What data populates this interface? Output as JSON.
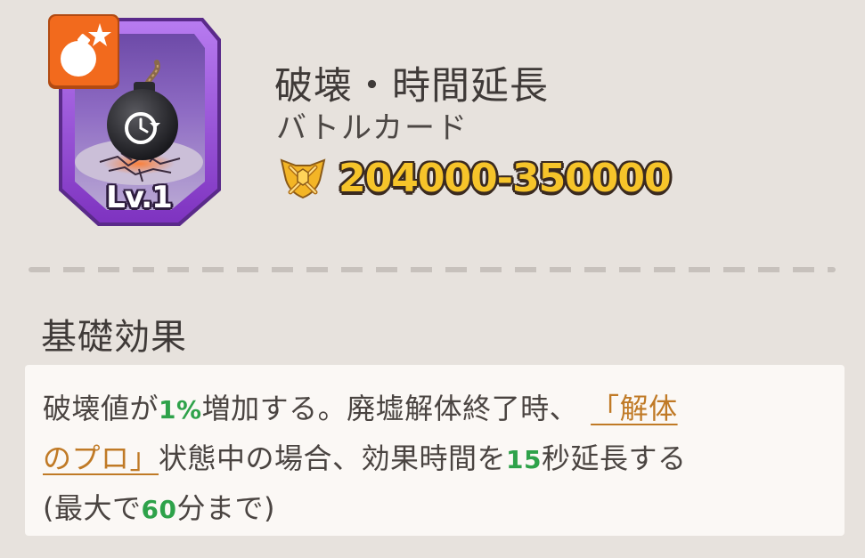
{
  "card": {
    "level_label": "Lv.1",
    "frame_color": "#9a4fd6",
    "corner_badge_color": "#f26a1d",
    "corner_badge_icon": "bomb-star-icon",
    "art_icon": "bomb-timer-icon"
  },
  "header": {
    "title": "破壊・時間延長",
    "subtitle": "バトルカード",
    "score_icon": "crossed-swords-shield-icon",
    "score_range": "204000-350000"
  },
  "section": {
    "heading": "基礎効果"
  },
  "effect": {
    "line1": {
      "part1": "破壊値が",
      "value1": "1%",
      "part2": "増加する。廃墟解体終了時、",
      "link_part1": "「解体"
    },
    "line2": {
      "link_part2": "のプロ」",
      "part3": "状態中の場合、効果時間を",
      "value2": "15",
      "part4": "秒延長する"
    },
    "line3": {
      "part5": "(最大で",
      "value3": "60",
      "part6": "分まで)"
    }
  },
  "colors": {
    "background": "#e7e2dd",
    "panel": "#fbf8f5",
    "number_green": "#2ea24a",
    "link_orange": "#c07a26",
    "score_gold": "#f6c42a"
  }
}
